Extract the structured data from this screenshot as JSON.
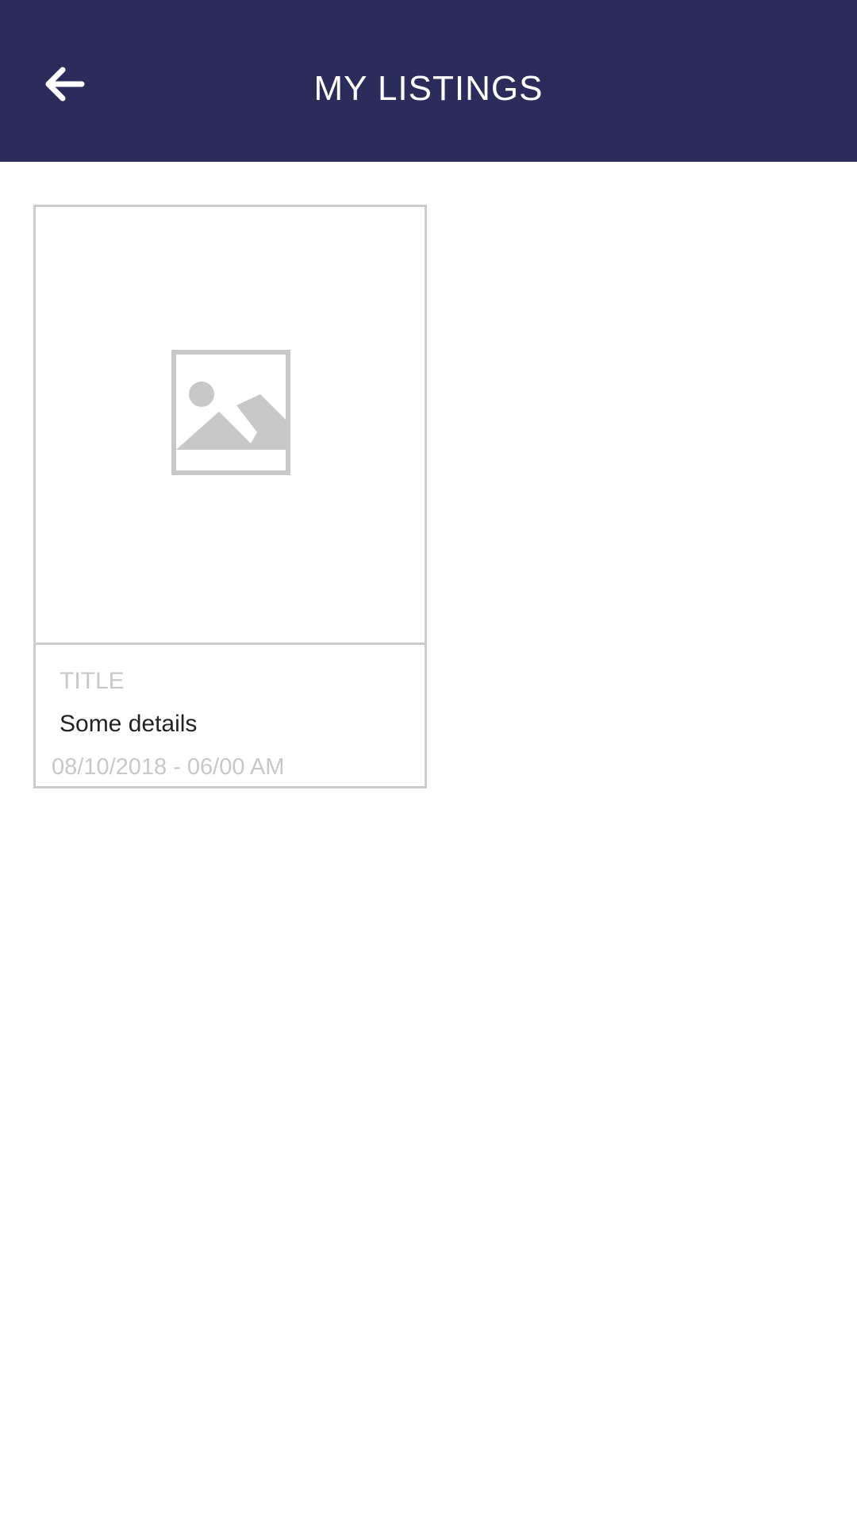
{
  "header": {
    "title": "MY LISTINGS",
    "background_color": "#2c2c5c",
    "back_icon": "arrow-left-icon"
  },
  "listings": [
    {
      "image_icon": "image-placeholder-icon",
      "title": "TITLE",
      "details": "Some details",
      "date": "08/10/2018 - 06/00 AM"
    }
  ]
}
